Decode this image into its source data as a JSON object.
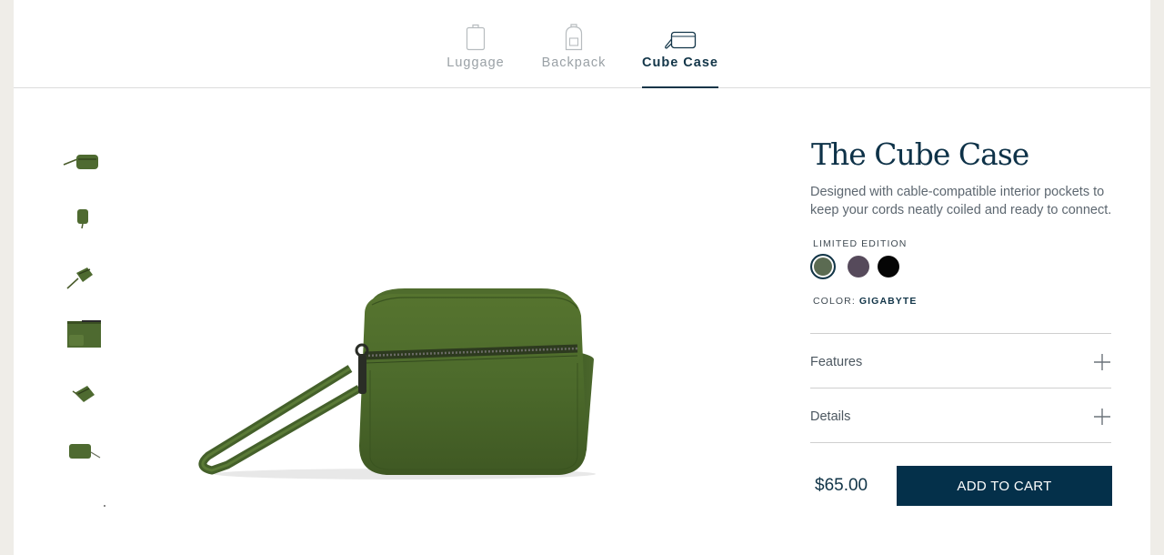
{
  "tabs": [
    {
      "label": "Luggage",
      "icon": "luggage-icon",
      "active": false
    },
    {
      "label": "Backpack",
      "icon": "backpack-icon",
      "active": false
    },
    {
      "label": "Cube Case",
      "icon": "cube-case-icon",
      "active": true
    }
  ],
  "product": {
    "title": "The Cube Case",
    "description": "Designed with cable-compatible interior pockets to keep your cords neatly coiled and ready to connect.",
    "edition_label": "LIMITED EDITION",
    "color_label": "COLOR:",
    "selected_color": "GIGABYTE",
    "swatches": [
      {
        "color": "#5b6b52",
        "selected": true
      },
      {
        "color": "#564a5b",
        "selected": false
      },
      {
        "color": "#050505",
        "selected": false
      }
    ],
    "price": "$65.00",
    "add_to_cart_label": "ADD TO CART"
  },
  "accordions": [
    {
      "label": "Features"
    },
    {
      "label": "Details"
    }
  ],
  "colors": {
    "accent": "#04304a",
    "product_green": "#4e6a30",
    "page_background": "#efede8"
  }
}
